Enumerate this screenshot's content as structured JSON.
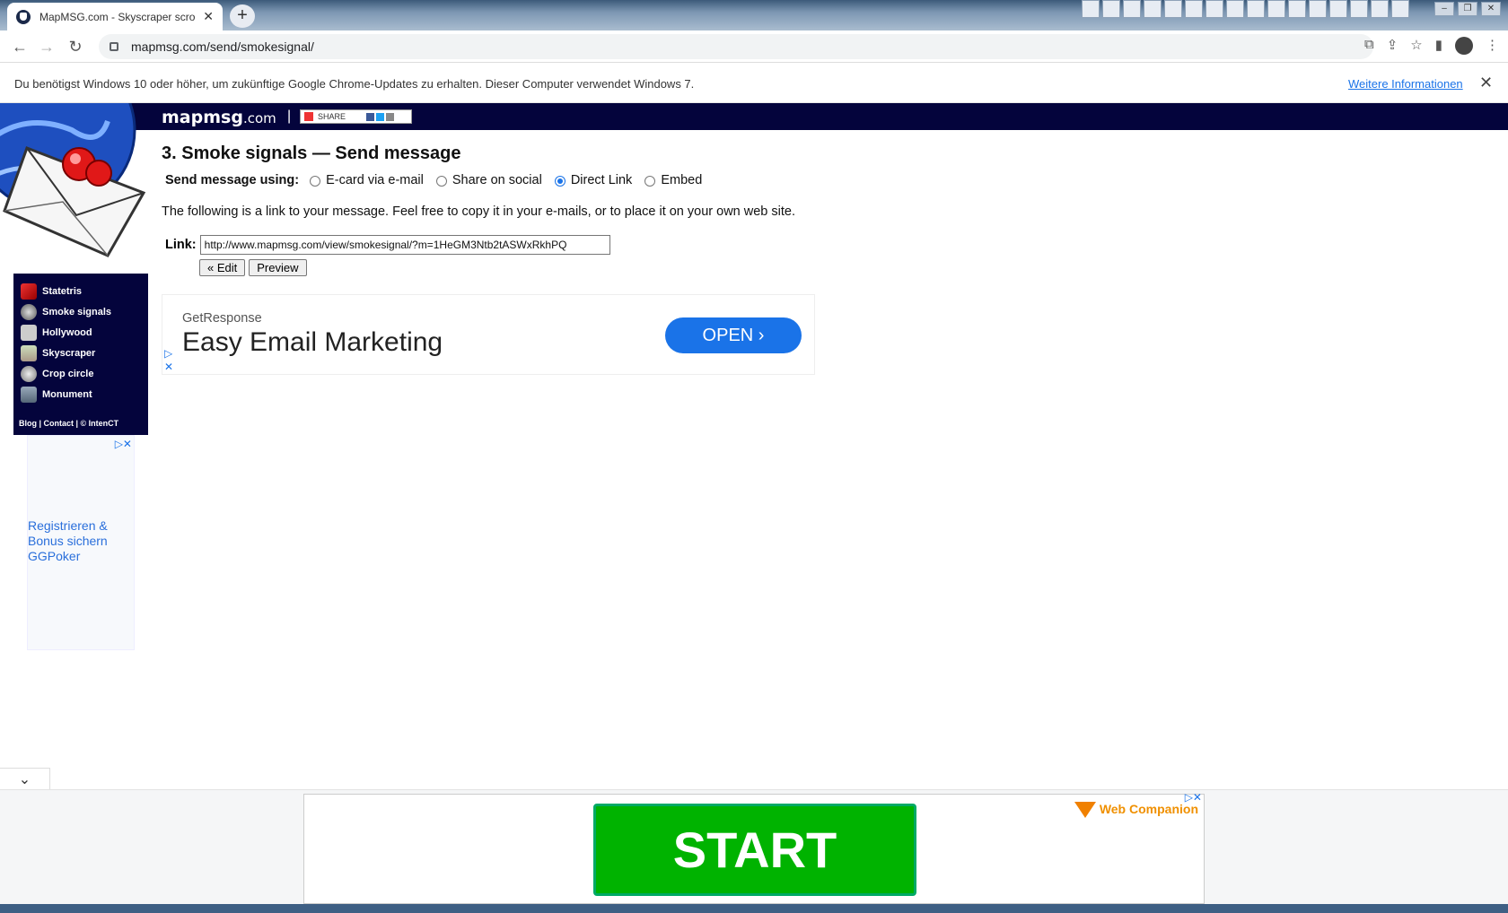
{
  "browser": {
    "tab_title": "MapMSG.com - Skyscraper scroll",
    "url": "mapmsg.com/send/smokesignal/",
    "infobar_message": "Du benötigst Windows 10 oder höher, um zukünftige Google Chrome-Updates zu erhalten. Dieser Computer verwendet Windows 7.",
    "infobar_link": "Weitere Informationen"
  },
  "site": {
    "brand": "mapmsg",
    "brand_suffix": ".com",
    "pipe": "|",
    "share_label": "SHARE"
  },
  "sidebar": {
    "items": [
      {
        "label": "Statetris",
        "icon": "statetris-icon"
      },
      {
        "label": "Smoke signals",
        "icon": "smoke-signals-icon"
      },
      {
        "label": "Hollywood",
        "icon": "hollywood-icon"
      },
      {
        "label": "Skyscraper",
        "icon": "skyscraper-icon"
      },
      {
        "label": "Crop circle",
        "icon": "crop-circle-icon"
      },
      {
        "label": "Monument",
        "icon": "monument-icon"
      }
    ],
    "footer": "Blog | Contact | © IntenCT",
    "ad_text_1": "Registrieren &",
    "ad_text_2": "Bonus sichern",
    "ad_text_3": "GGPoker"
  },
  "main": {
    "heading": "3. Smoke signals — Send message",
    "send_label": "Send message using:",
    "options": [
      {
        "label": "E-card via e-mail",
        "selected": false
      },
      {
        "label": "Share on social",
        "selected": false
      },
      {
        "label": "Direct Link",
        "selected": true
      },
      {
        "label": "Embed",
        "selected": false
      }
    ],
    "description": "The following is a link to your message. Feel free to copy it in your e-mails, or to place it on your own web site.",
    "link_label": "Link:",
    "link_value": "http://www.mapmsg.com/view/smokesignal/?m=1HeGM3Ntb2tASWxRkhPQ",
    "edit_button": "« Edit",
    "preview_button": "Preview"
  },
  "ad_banner": {
    "advertiser": "GetResponse",
    "headline": "Easy Email Marketing",
    "cta": "OPEN"
  },
  "bottom_ad": {
    "cta": "START",
    "brand": "Web Companion"
  }
}
